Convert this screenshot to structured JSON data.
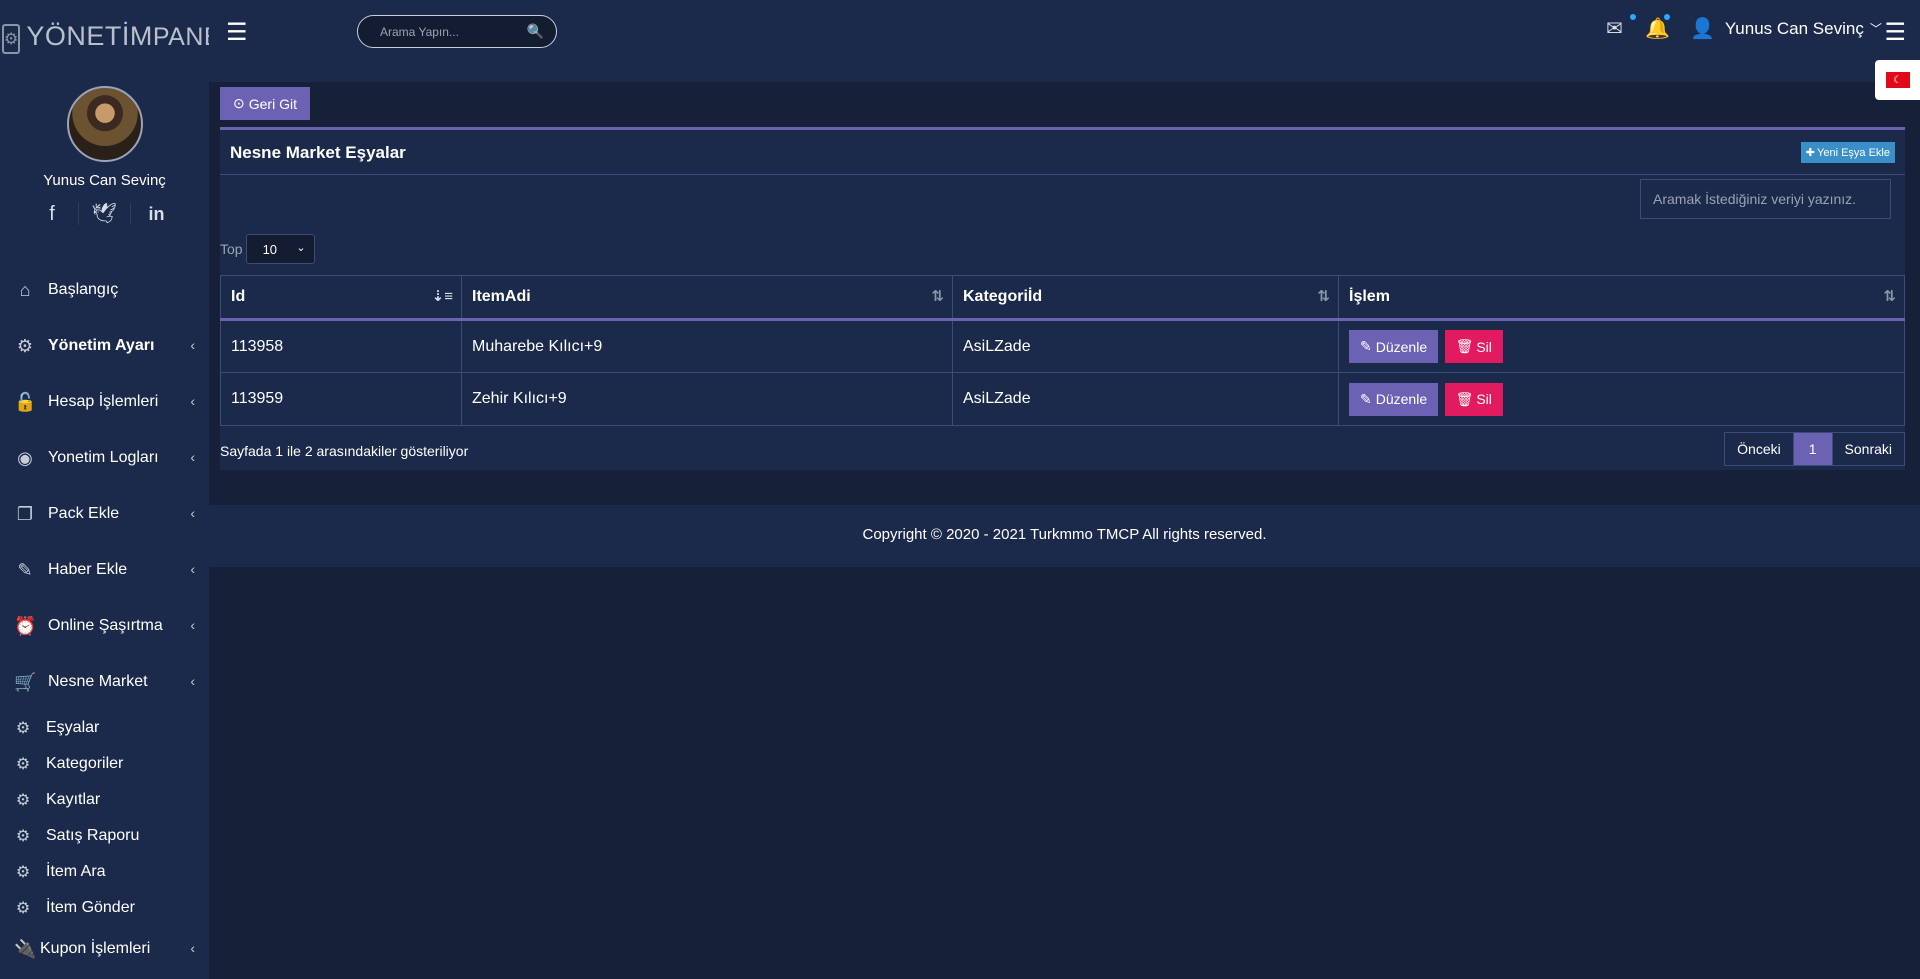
{
  "brand": {
    "logo_bold": "YÖNETİM",
    "logo_thin": "PANELİ"
  },
  "profile": {
    "name": "Yunus Can Sevinç"
  },
  "socials": [
    {
      "icon": "facebook-icon",
      "glyph": "f"
    },
    {
      "icon": "twitter-icon",
      "glyph": "🐦"
    },
    {
      "icon": "linkedin-icon",
      "glyph": "in"
    }
  ],
  "menu": [
    {
      "label": "Başlangıç",
      "icon": "home-icon",
      "chevron": false
    },
    {
      "label": "Yönetim Ayarı",
      "icon": "gear-icon",
      "chevron": true
    },
    {
      "label": "Hesap İşlemleri",
      "icon": "lock-icon",
      "chevron": true
    },
    {
      "label": "Yonetim Logları",
      "icon": "eye-icon",
      "chevron": true
    },
    {
      "label": "Pack Ekle",
      "icon": "copy-icon",
      "chevron": true
    },
    {
      "label": "Haber Ekle",
      "icon": "edit-icon",
      "chevron": true
    },
    {
      "label": "Online Şaşırtma",
      "icon": "alarm-icon",
      "chevron": true
    },
    {
      "label": "Nesne Market",
      "icon": "cart-icon",
      "chevron": true
    }
  ],
  "submenu": [
    "Eşyalar",
    "Kategoriler",
    "Kayıtlar",
    "Satış Raporu",
    "İtem Ara",
    "İtem Gönder"
  ],
  "menu_last": {
    "label": "Kupon İşlemleri",
    "icon": "plug-icon"
  },
  "topbar": {
    "search_placeholder": "Arama Yapın...",
    "user_name": "Yunus Can Sevinç"
  },
  "content": {
    "back_label": "Geri Git",
    "panel_title": "Nesne Market Eşyalar",
    "add_label": "Yeni Eşya Ekle",
    "filter_placeholder": "Aramak İstediğiniz veriyi yazınız.",
    "length_label": "Top",
    "length_value": "10",
    "columns": [
      "Id",
      "ItemAdi",
      "Kategoriİd",
      "İşlem"
    ],
    "rows": [
      {
        "id": "113958",
        "item": "Muharebe Kılıcı+9",
        "category": "AsiLZade"
      },
      {
        "id": "113959",
        "item": "Zehir Kılıcı+9",
        "category": "AsiLZade"
      }
    ],
    "edit_label": "Düzenle",
    "delete_label": "Sil",
    "info": "Sayfada 1 ile 2 arasındakiler gösteriliyor",
    "pager": {
      "prev": "Önceki",
      "current": "1",
      "next": "Sonraki"
    }
  },
  "footer": {
    "copyright": "Copyright © 2020 - 2021 Turkmmo TMCP All rights reserved."
  },
  "colors": {
    "accent": "#6c62b3",
    "danger": "#e21a60",
    "info": "#3a8fc8",
    "background": "#162038",
    "panel": "#1b2a4a"
  }
}
